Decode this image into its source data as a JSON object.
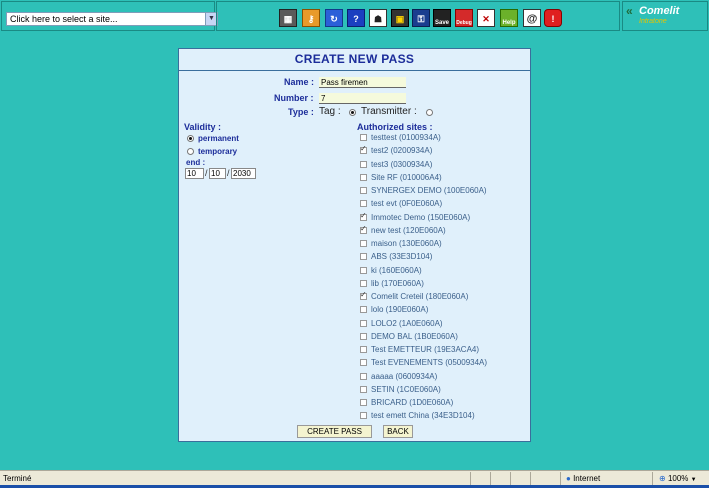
{
  "topbar": {
    "site_select_value": "Click here to select a site...",
    "toolbar_icons": [
      "building-icon",
      "key-icon",
      "refresh-icon",
      "help-icon",
      "user-icon",
      "badge-icon",
      "key-add-icon",
      "save-icon",
      "debug-icon",
      "tools-icon",
      "help-book-icon",
      "at-icon",
      "power-icon"
    ],
    "save_label": "Save",
    "debug_label": "Debug",
    "help_label": "Help",
    "logo_text": "Comelit",
    "logo_sub": "Intratone"
  },
  "form": {
    "title": "CREATE NEW PASS",
    "name_label": "Name :",
    "name_value": "Pass firemen",
    "number_label": "Number :",
    "number_value": "7",
    "type_label": "Type :",
    "type_tag": "Tag :",
    "type_transmitter": "Transmitter :",
    "validity_label": "Validity :",
    "permanent_label": "permanent",
    "temporary_label": "temporary",
    "end_label": "end :",
    "end_day": "10",
    "end_month": "10",
    "end_year": "2030",
    "date_sep": "/",
    "authorized_label": "Authorized sites :",
    "sites": [
      {
        "label": "testtest (0100934A)",
        "checked": false
      },
      {
        "label": "test2 (0200934A)",
        "checked": true
      },
      {
        "label": "test3 (0300934A)",
        "checked": false
      },
      {
        "label": "Site RF (010006A4)",
        "checked": false
      },
      {
        "label": "SYNERGEX DEMO (100E060A)",
        "checked": false
      },
      {
        "label": "test evt (0F0E060A)",
        "checked": false
      },
      {
        "label": "Immotec Demo (150E060A)",
        "checked": true
      },
      {
        "label": "new test (120E060A)",
        "checked": true
      },
      {
        "label": "maison (130E060A)",
        "checked": false
      },
      {
        "label": "ABS (33E3D104)",
        "checked": false
      },
      {
        "label": "ki (160E060A)",
        "checked": false
      },
      {
        "label": "lib (170E060A)",
        "checked": false
      },
      {
        "label": "Comelit Creteil (180E060A)",
        "checked": true
      },
      {
        "label": "lolo (190E060A)",
        "checked": false
      },
      {
        "label": "LOLO2 (1A0E060A)",
        "checked": false
      },
      {
        "label": "DEMO BAL (1B0E060A)",
        "checked": false
      },
      {
        "label": "Test EMETTEUR (19E3ACA4)",
        "checked": false
      },
      {
        "label": "Test EVENEMENTS (0500934A)",
        "checked": false
      },
      {
        "label": "aaaaa (0600934A)",
        "checked": false
      },
      {
        "label": "SETIN (1C0E060A)",
        "checked": false
      },
      {
        "label": "BRICARD (1D0E060A)",
        "checked": false
      },
      {
        "label": "test emett China (34E3D104)",
        "checked": false
      }
    ],
    "create_button": "CREATE PASS",
    "back_button": "BACK"
  },
  "statusbar": {
    "status": "Terminé",
    "zone": "Internet",
    "zoom": "100%"
  }
}
